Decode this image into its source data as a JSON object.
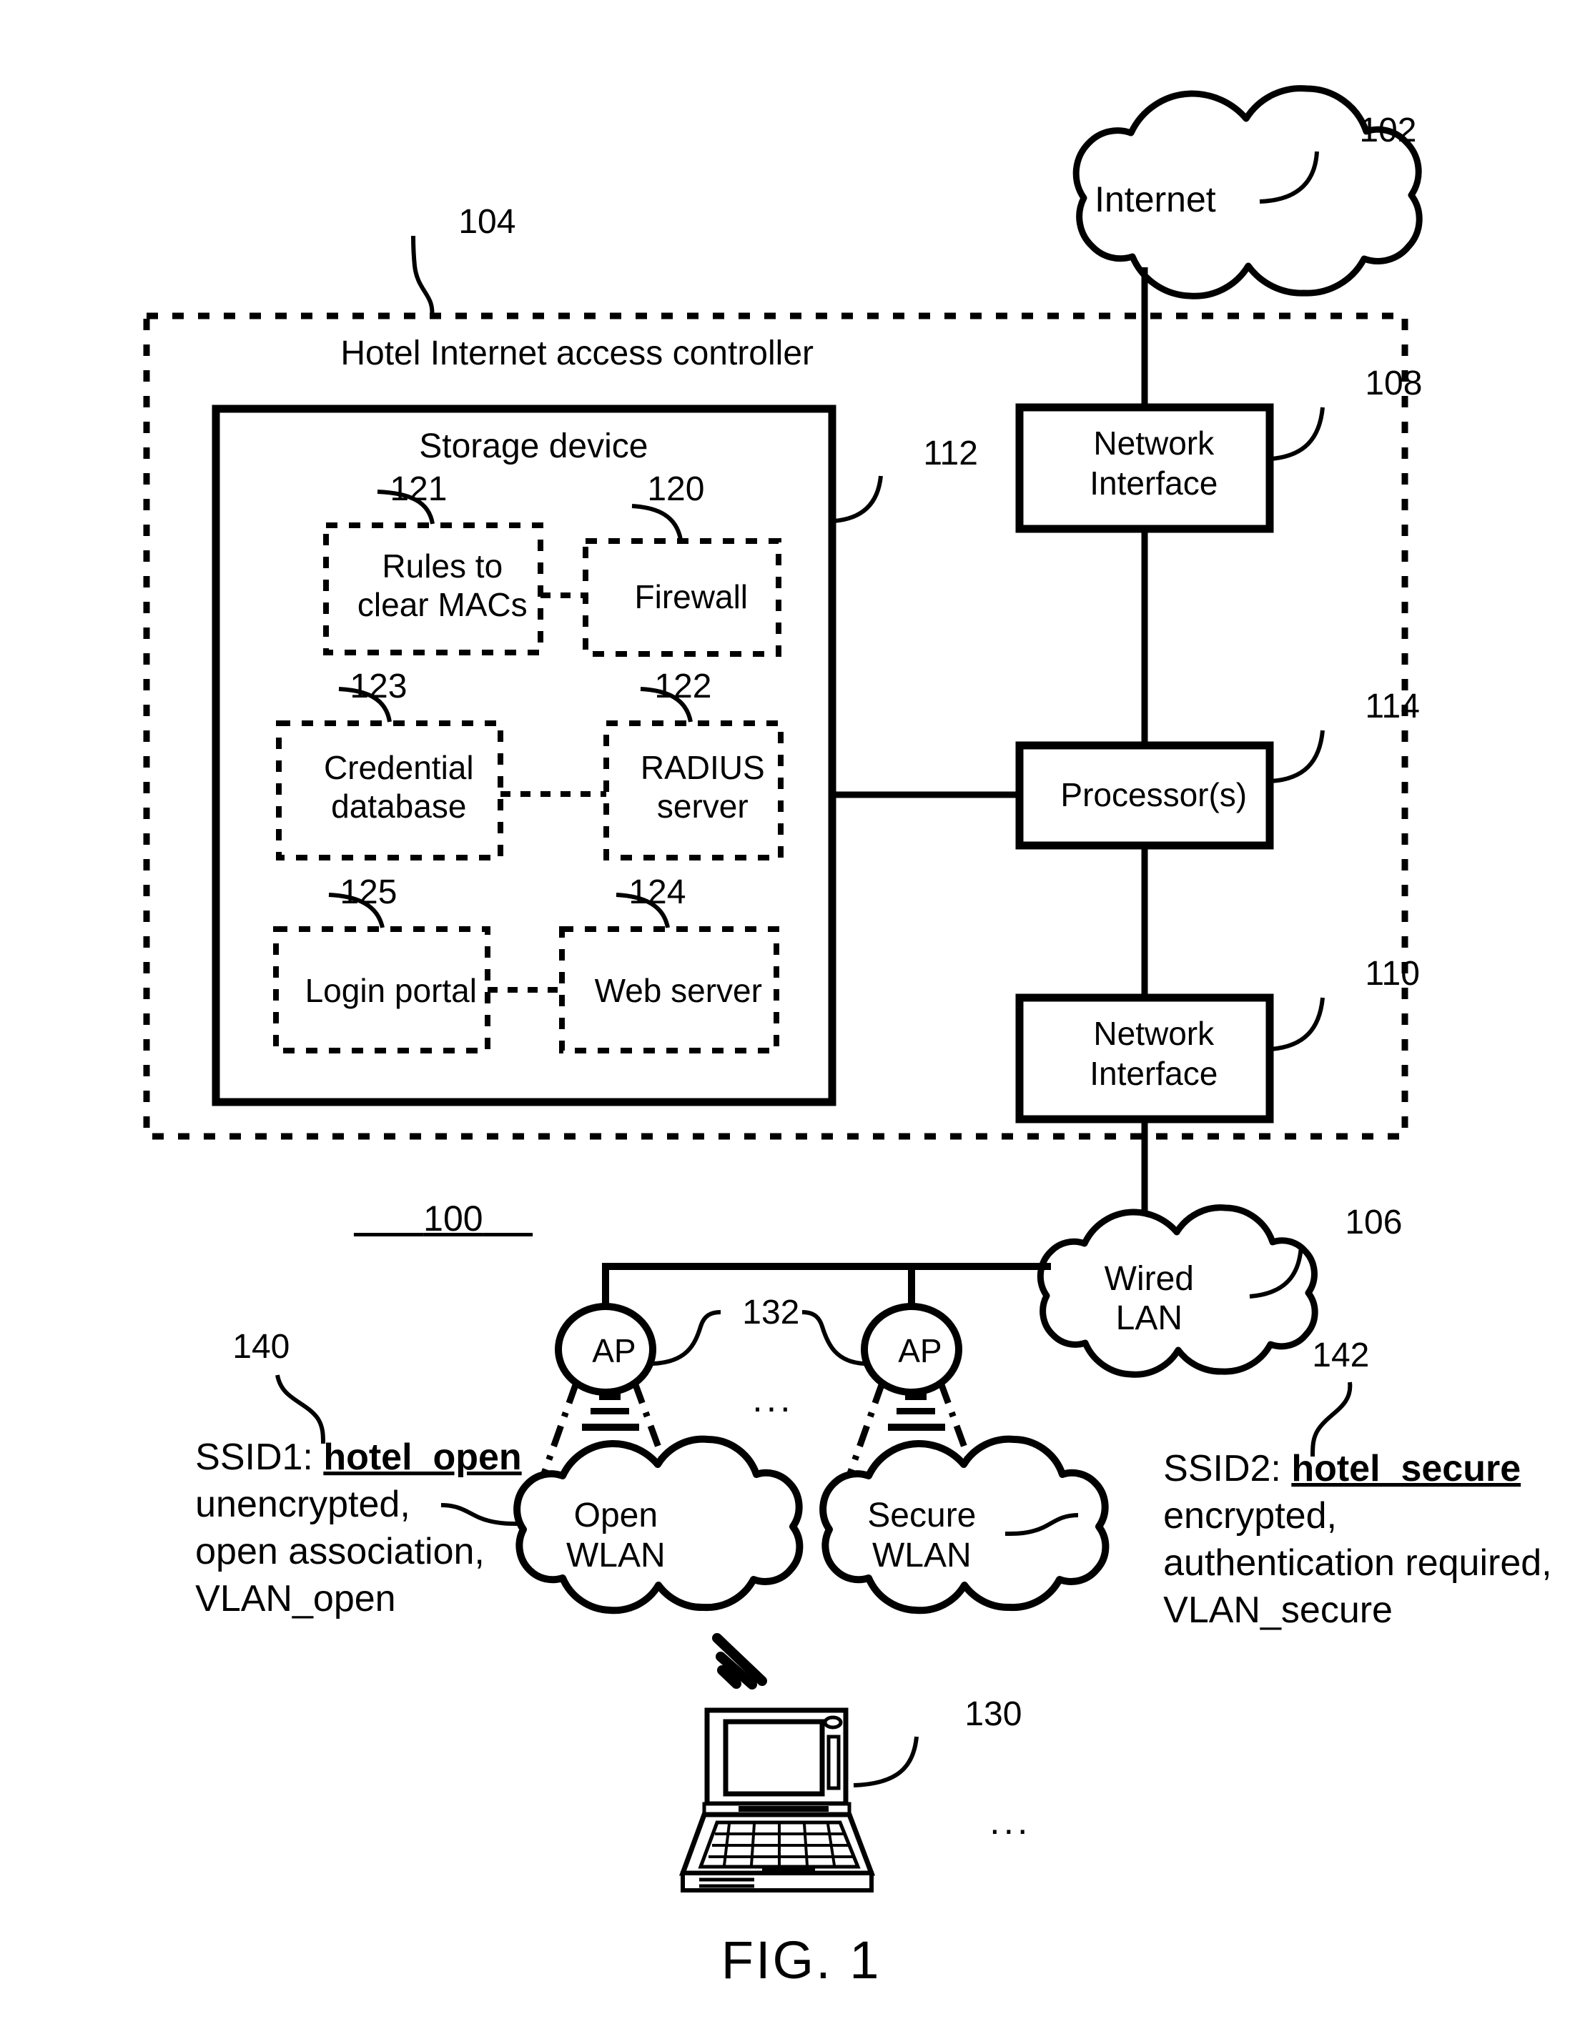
{
  "figure": {
    "caption": "FIG. 1",
    "system_ref": "100"
  },
  "internet": {
    "label": "Internet",
    "ref": "102"
  },
  "controller": {
    "title": "Hotel Internet access controller",
    "ref": "104"
  },
  "storage": {
    "title": "Storage device",
    "ref": "112",
    "modules": [
      {
        "ref": "121",
        "label_line1": "Rules to",
        "label_line2": "clear MACs"
      },
      {
        "ref": "120",
        "label_line1": "Firewall",
        "label_line2": ""
      },
      {
        "ref": "123",
        "label_line1": "Credential",
        "label_line2": "database"
      },
      {
        "ref": "122",
        "label_line1": "RADIUS",
        "label_line2": "server"
      },
      {
        "ref": "125",
        "label_line1": "Login portal",
        "label_line2": ""
      },
      {
        "ref": "124",
        "label_line1": "Web server",
        "label_line2": ""
      }
    ]
  },
  "network_interface_top": {
    "label_line1": "Network",
    "label_line2": "Interface",
    "ref": "108"
  },
  "processor": {
    "label": "Processor(s)",
    "ref": "114"
  },
  "network_interface_bottom": {
    "label_line1": "Network",
    "label_line2": "Interface",
    "ref": "110"
  },
  "wired_lan": {
    "label_line1": "Wired",
    "label_line2": "LAN",
    "ref": "106"
  },
  "access_points": {
    "label": "AP",
    "ref": "132",
    "ellipsis": "..."
  },
  "wlans": [
    {
      "label_line1": "Open",
      "label_line2": "WLAN"
    },
    {
      "label_line1": "Secure",
      "label_line2": "WLAN"
    }
  ],
  "ssid_open": {
    "ref": "140",
    "prefix": "SSID1: ",
    "name": "hotel_open",
    "line2": "unencrypted,",
    "line3": "open association,",
    "line4": "VLAN_open"
  },
  "ssid_secure": {
    "ref": "142",
    "prefix": "SSID2: ",
    "name": "hotel_secure",
    "line2": "encrypted,",
    "line3": "authentication required,",
    "line4": "VLAN_secure"
  },
  "client": {
    "ref": "130",
    "ellipsis": "..."
  }
}
